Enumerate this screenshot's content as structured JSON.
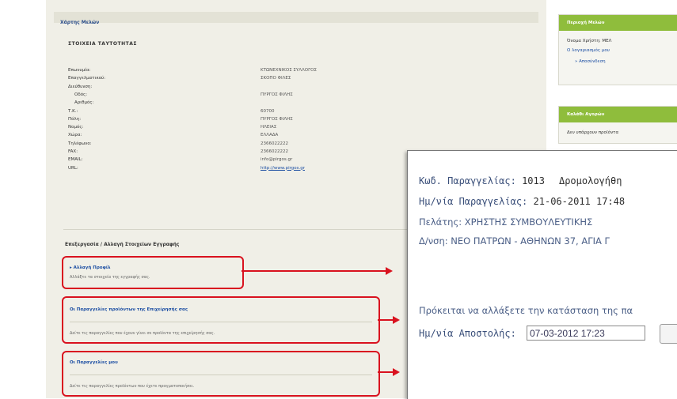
{
  "breadcrumb": {
    "label": "Χάρτης Μελών"
  },
  "identity": {
    "title": "ΣΤΟΙΧΕΙΑ ΤΑΥΤΟΤΗΤΑΣ",
    "rows": [
      {
        "label": "Επωνυμία:",
        "value": "ΚΤΩΝΕΧΝΙΚΟΣ ΣΥΛΛΟΓΟΣ"
      },
      {
        "label": "Επαγγελματικού:",
        "value": "ΣΚΟΠΟ ΦΙΛΕΣ"
      },
      {
        "label": "Διεύθυνση:",
        "value": ""
      },
      {
        "label": "Οδός:",
        "value": "ΠΥΡΓΟΣ ΦΙΛΗΣ"
      },
      {
        "label": "Αριθμός:",
        "value": ""
      },
      {
        "label": "Τ.Κ.:",
        "value": "60700"
      },
      {
        "label": "Πόλη:",
        "value": "ΠΥΡΓΟΣ ΦΙΛΗΣ"
      },
      {
        "label": "Νομός:",
        "value": "ΗΛΕΙΑΣ"
      },
      {
        "label": "Χώρα:",
        "value": "ΕΛΛΑΔΑ"
      },
      {
        "label": "Τηλέφωνο:",
        "value": "2366022222"
      },
      {
        "label": "FAX:",
        "value": "2366022222"
      },
      {
        "label": "EMAIL:",
        "value": "info@pirgos.gr"
      },
      {
        "label": "URL:",
        "value": "http://www.pirgos.gr"
      }
    ]
  },
  "edit_section": {
    "heading": "Επεξεργασία / Αλλαγή Στοιχείων Εγγραφής",
    "boxes": [
      {
        "title": "▸ Αλλαγή Προφίλ",
        "desc": "Αλλάξτε τα στοιχεία της εγγραφής σας."
      },
      {
        "title": "Οι Παραγγελίες προϊόντων της Επιχείρησής σας",
        "desc": "Δείτε τις παραγγελίες που έχουν γίνει σε προϊόντα της επιχείρησής σας."
      },
      {
        "title": "Οι Παραγγελίες μου",
        "desc": "Δείτε τις παραγγελίες προϊόντων που έχετε πραγματοποιήσει."
      }
    ]
  },
  "sidebar": {
    "card1": {
      "heading": "Περιοχή Μελών",
      "user": "Όνομα Χρήστη: ΜΕΛ",
      "link": "Ο λογαριασμός μου",
      "sub": "» Αποσύνδεση"
    },
    "card2": {
      "heading": "Καλάθι Αγορών",
      "text": "Δεν υπάρχουν προϊόντα"
    }
  },
  "order_panel": {
    "code_label": "Κωδ. Παραγγελίας:",
    "code_value": "1013",
    "routing_label": "Δρομολογήθη",
    "date_label": "Ημ/νία Παραγγελίας:",
    "date_value": "21-06-2011 17:48",
    "customer_label": "Πελάτης:",
    "customer_value": "ΧΡΗΣΤΗΣ ΣΥΜΒΟΥΛΕΥΤΙΚΗΣ",
    "address_label": "Δ/νση:",
    "address_value": "ΝΕΟ ΠΑΤΡΩΝ - ΑΘΗΝΩΝ 37, ΑΓΙΑ Γ",
    "notice": "Πρόκειται να αλλάξετε την κατάσταση της πα",
    "ship_label": "Ημ/νία Αποστολής:",
    "ship_value": "07-03-2012 17:23"
  },
  "colors": {
    "accent_red": "#d9121f",
    "sidebar_green": "#8fbd3c",
    "link_blue": "#1d4fa3"
  }
}
